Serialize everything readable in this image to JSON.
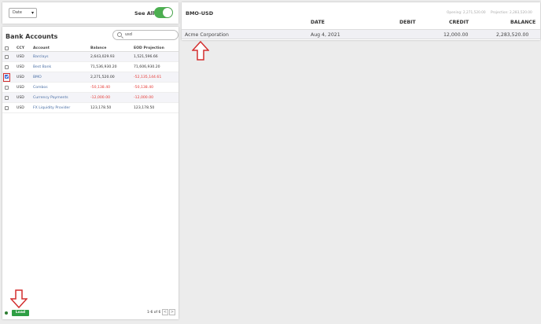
{
  "filter": {
    "date_select": "Date",
    "see_all_label": "See All:",
    "see_all_on": true
  },
  "accounts": {
    "title": "Bank Accounts",
    "search_value": "usd",
    "headers": {
      "ccy": "CCY",
      "account": "Account",
      "balance": "Balance",
      "eod": "EOD Projection"
    },
    "rows": [
      {
        "ccy": "USD",
        "account": "Barclays",
        "balance": "2,643,029.93",
        "eod": "1,521,596.66",
        "checked": false,
        "negative": false
      },
      {
        "ccy": "USD",
        "account": "Best Bank",
        "balance": "71,536,930.20",
        "eod": "71,606,930.20",
        "checked": false,
        "negative": false
      },
      {
        "ccy": "USD",
        "account": "BMO",
        "balance": "2,271,520.00",
        "eod": "-52,135,144.61",
        "checked": true,
        "negative": true
      },
      {
        "ccy": "USD",
        "account": "Combos",
        "balance": "-50,138.40",
        "eod": "-50,138.40",
        "checked": false,
        "negative": true
      },
      {
        "ccy": "USD",
        "account": "Currency Payments",
        "balance": "-12,000.00",
        "eod": "-12,000.00",
        "checked": false,
        "negative": true
      },
      {
        "ccy": "USD",
        "account": "FX Liquidity Provider",
        "balance": "123,178.50",
        "eod": "123,178.50",
        "checked": false,
        "negative": false
      }
    ]
  },
  "footer": {
    "load_label": "Load",
    "pager_text": "1-6 of 6",
    "prev": "<",
    "next": ">"
  },
  "detail": {
    "title": "BMO-USD",
    "opening": "Opening: 2,271,520.00",
    "projection": "Projection: 2,283,520.00",
    "headers": {
      "date": "DATE",
      "debit": "DEBIT",
      "credit": "CREDIT",
      "balance": "BALANCE"
    },
    "row": {
      "name": "Acme Corporation",
      "date": "Aug 4, 2021",
      "debit": "",
      "credit": "12,000.00",
      "balance": "2,283,520.00"
    }
  },
  "colors": {
    "accent_green": "#2e9e44",
    "negative_red": "#e53935",
    "annotation_red": "#d32f2f",
    "link_blue": "#4a6fa5"
  }
}
